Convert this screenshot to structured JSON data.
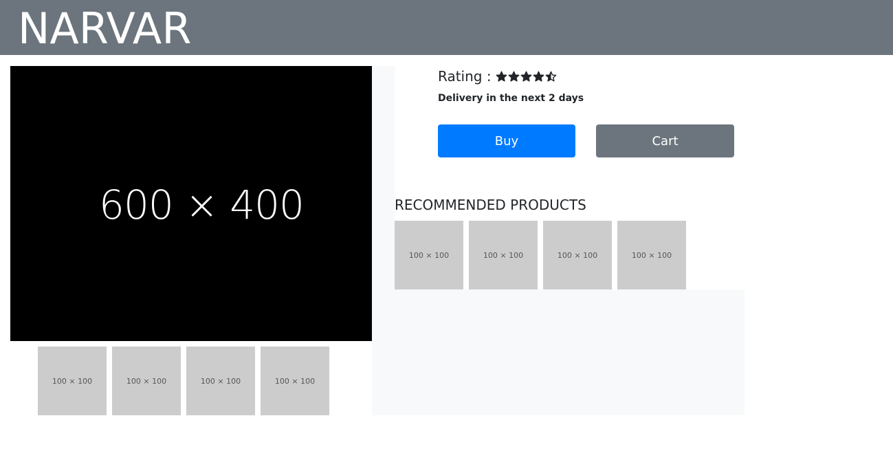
{
  "header": {
    "brand": "NARVAR",
    "background_color": "#6c757d"
  },
  "product": {
    "main_image_label": "600 × 400",
    "thumbnails": [
      {
        "label": "100 × 100"
      },
      {
        "label": "100 × 100"
      },
      {
        "label": "100 × 100"
      },
      {
        "label": "100 × 100"
      }
    ],
    "rating_label": "Rating :",
    "rating_value": 4.5,
    "rating_max": 5,
    "delivery_text": "Delivery in the next 2 days"
  },
  "actions": {
    "buy_label": "Buy",
    "cart_label": "Cart",
    "buy_color": "#007bff",
    "cart_color": "#6c757d"
  },
  "recommended": {
    "title": "RECOMMENDED PRODUCTS",
    "items": [
      {
        "label": "100 × 100"
      },
      {
        "label": "100 × 100"
      },
      {
        "label": "100 × 100"
      },
      {
        "label": "100 × 100"
      }
    ]
  },
  "icons": {
    "star_full": "star-icon",
    "star_half": "star-half-icon"
  }
}
